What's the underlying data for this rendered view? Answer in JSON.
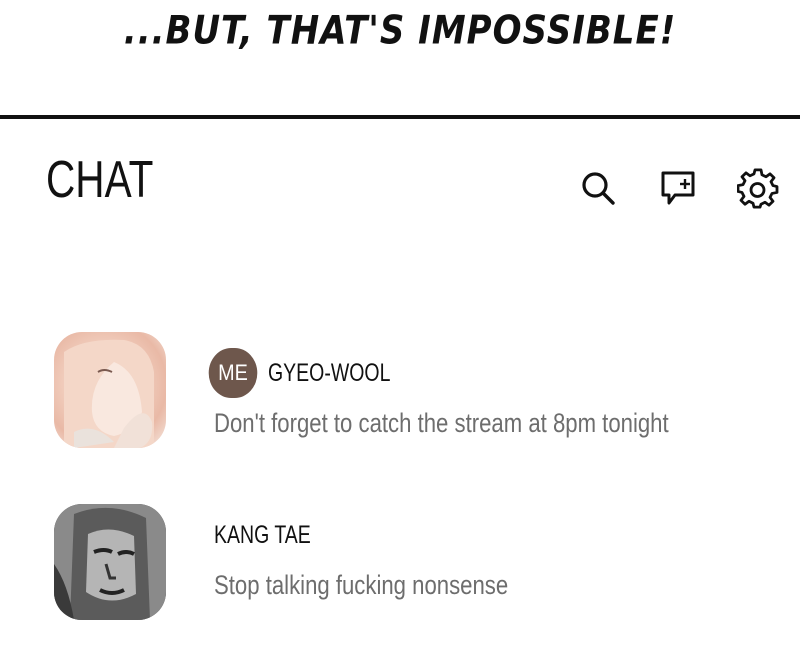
{
  "caption": "...BUT, THAT'S IMPOSSIBLE!",
  "header": {
    "title": "CHAT",
    "icons": [
      "search-icon",
      "new-chat-icon",
      "settings-icon"
    ]
  },
  "chats": [
    {
      "badge": "ME",
      "name": "GYEO-WOOL",
      "message": "Don't forget to catch the stream at 8pm tonight"
    },
    {
      "name": "KANG TAE",
      "message": "Stop talking fucking nonsense"
    }
  ],
  "colors": {
    "badge_bg": "#6e574c",
    "message_text": "#6d6d6d",
    "text": "#111111"
  }
}
